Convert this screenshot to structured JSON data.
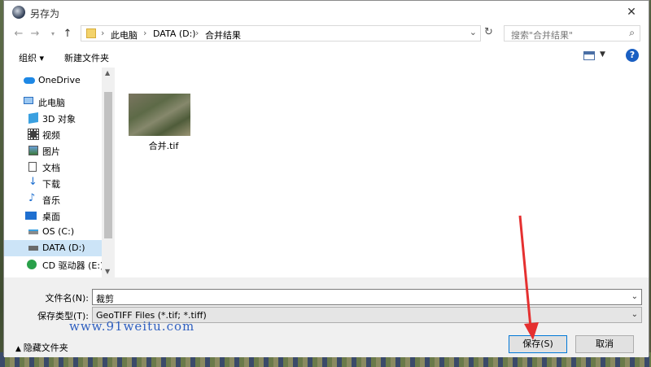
{
  "window": {
    "title": "另存为",
    "close_icon": "close-icon"
  },
  "address": {
    "crumbs": [
      "此电脑",
      "DATA (D:)",
      "合并结果"
    ],
    "search_placeholder": "搜索\"合并结果\""
  },
  "toolbar": {
    "organize": "组织 ▾",
    "new_folder": "新建文件夹",
    "help": "?"
  },
  "nav": {
    "items": [
      {
        "label": "OneDrive",
        "icon": "cloud-icon"
      },
      {
        "label": "此电脑",
        "icon": "computer-icon"
      },
      {
        "label": "3D 对象",
        "icon": "cube-icon"
      },
      {
        "label": "视频",
        "icon": "video-icon"
      },
      {
        "label": "图片",
        "icon": "picture-icon"
      },
      {
        "label": "文档",
        "icon": "document-icon"
      },
      {
        "label": "下载",
        "icon": "download-icon"
      },
      {
        "label": "音乐",
        "icon": "music-icon"
      },
      {
        "label": "桌面",
        "icon": "desktop-icon"
      },
      {
        "label": "OS (C:)",
        "icon": "drive-icon"
      },
      {
        "label": "DATA (D:)",
        "icon": "drive-icon",
        "selected": true
      },
      {
        "label": "CD 驱动器 (E:) I",
        "icon": "cd-drive-icon"
      }
    ]
  },
  "files": [
    {
      "name": "合并.tif",
      "icon": "tif-thumbnail"
    }
  ],
  "form": {
    "filename_label": "文件名(N):",
    "filename_value": "裁剪",
    "filetype_label": "保存类型(T):",
    "filetype_value": "GeoTIFF Files (*.tif; *.tiff)"
  },
  "footer": {
    "hide_folders": "隐藏文件夹",
    "save": "保存(S)",
    "cancel": "取消",
    "watermark": "www.91weitu.com"
  },
  "colors": {
    "accent": "#0078d7",
    "arrow": "#e53030",
    "selection": "#cce4f7"
  }
}
